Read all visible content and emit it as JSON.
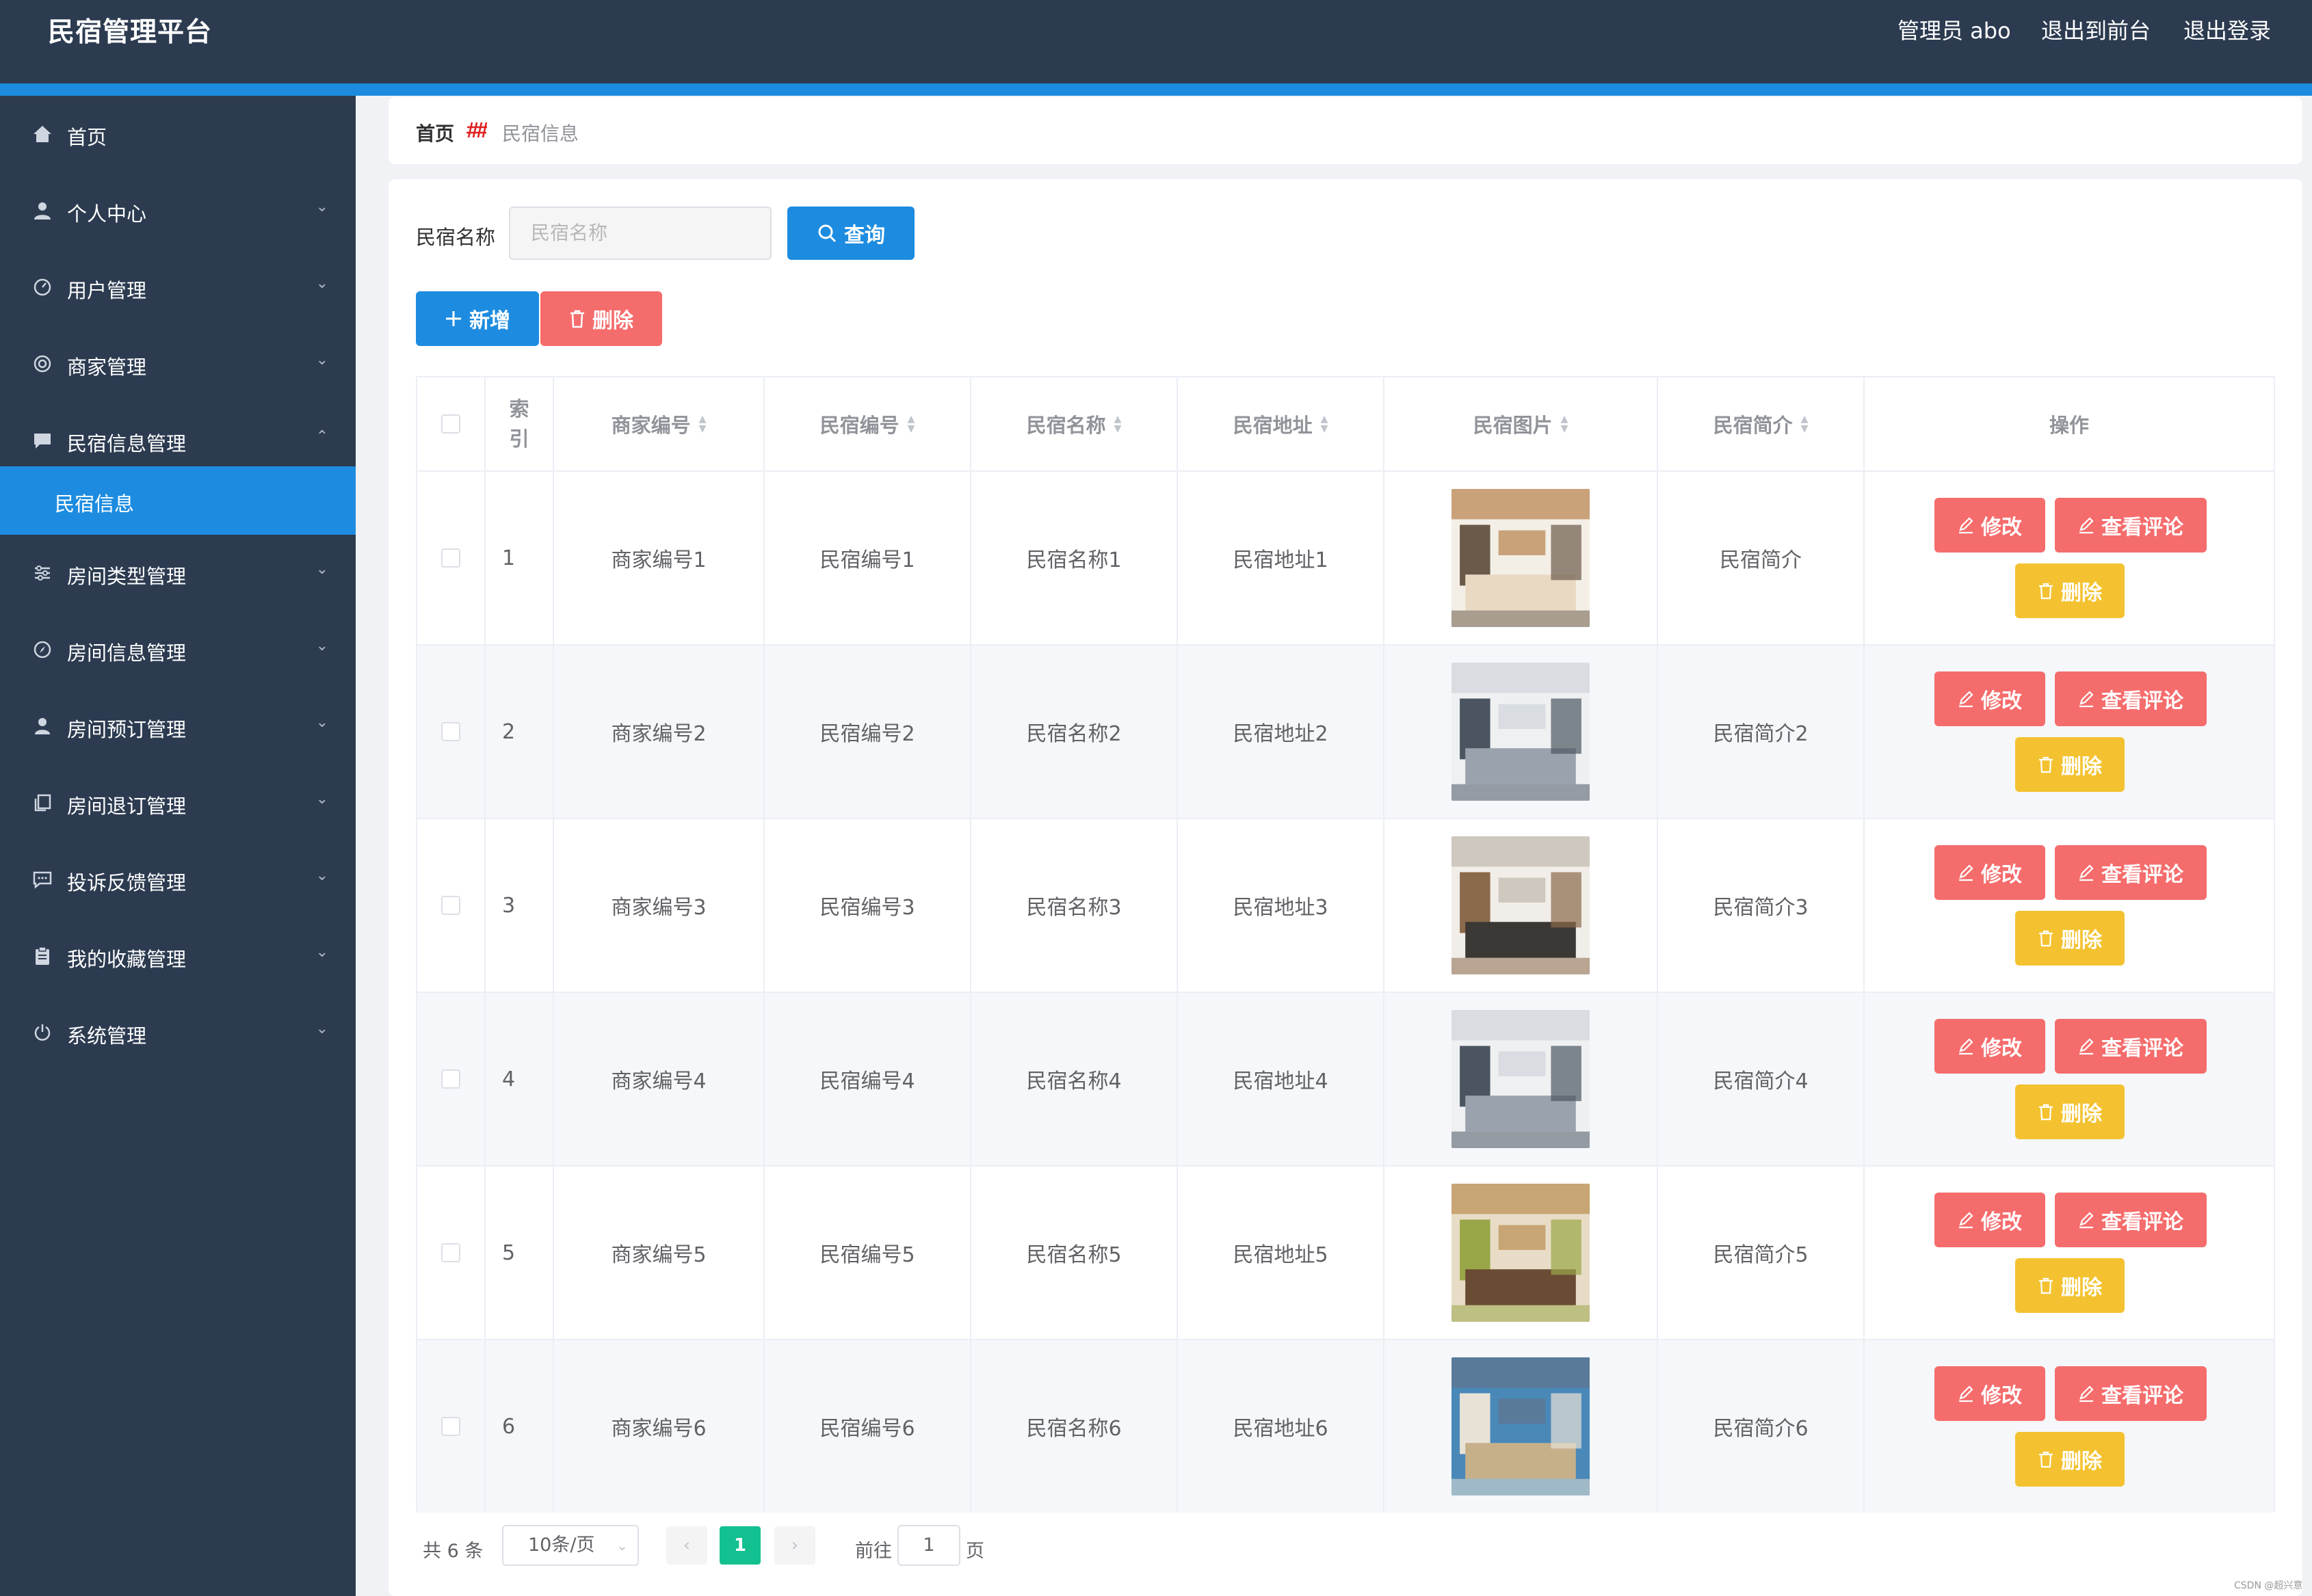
{
  "app": {
    "title": "民宿管理平台"
  },
  "topnav": {
    "admin": "管理员 abo",
    "to_front": "退出到前台",
    "logout": "退出登录"
  },
  "sidebar": {
    "items": [
      {
        "label": "首页",
        "icon": "home-icon"
      },
      {
        "label": "个人中心",
        "icon": "user-icon",
        "chevron": "⌄"
      },
      {
        "label": "用户管理",
        "icon": "gauge-icon",
        "chevron": "⌄"
      },
      {
        "label": "商家管理",
        "icon": "lifebuoy-icon",
        "chevron": "⌄"
      },
      {
        "label": "民宿信息管理",
        "icon": "chat-icon",
        "chevron": "⌃"
      },
      {
        "label": "房间类型管理",
        "icon": "sliders-icon",
        "chevron": "⌄"
      },
      {
        "label": "房间信息管理",
        "icon": "compass-icon",
        "chevron": "⌄"
      },
      {
        "label": "房间预订管理",
        "icon": "person-icon",
        "chevron": "⌄"
      },
      {
        "label": "房间退订管理",
        "icon": "copy-icon",
        "chevron": "⌄"
      },
      {
        "label": "投诉反馈管理",
        "icon": "message-icon",
        "chevron": "⌄"
      },
      {
        "label": "我的收藏管理",
        "icon": "clipboard-icon",
        "chevron": "⌄"
      },
      {
        "label": "系统管理",
        "icon": "power-icon",
        "chevron": "⌄"
      }
    ],
    "active_sub": "民宿信息"
  },
  "breadcrumb": {
    "home": "首页",
    "separator": "/",
    "current": "民宿信息"
  },
  "search": {
    "label": "民宿名称",
    "placeholder": "民宿名称",
    "button": "查询"
  },
  "actions": {
    "add": "新增",
    "delete": "删除"
  },
  "table": {
    "columns": [
      "",
      "索引",
      "商家编号",
      "民宿编号",
      "民宿名称",
      "民宿地址",
      "民宿图片",
      "民宿简介",
      "操作"
    ],
    "rows": [
      {
        "index": "1",
        "merchant": "商家编号1",
        "code": "民宿编号1",
        "name": "民宿名称1",
        "address": "民宿地址1",
        "intro": "民宿简介"
      },
      {
        "index": "2",
        "merchant": "商家编号2",
        "code": "民宿编号2",
        "name": "民宿名称2",
        "address": "民宿地址2",
        "intro": "民宿简介2"
      },
      {
        "index": "3",
        "merchant": "商家编号3",
        "code": "民宿编号3",
        "name": "民宿名称3",
        "address": "民宿地址3",
        "intro": "民宿简介3"
      },
      {
        "index": "4",
        "merchant": "商家编号4",
        "code": "民宿编号4",
        "name": "民宿名称4",
        "address": "民宿地址4",
        "intro": "民宿简介4"
      },
      {
        "index": "5",
        "merchant": "商家编号5",
        "code": "民宿编号5",
        "name": "民宿名称5",
        "address": "民宿地址5",
        "intro": "民宿简介5"
      },
      {
        "index": "6",
        "merchant": "商家编号6",
        "code": "民宿编号6",
        "name": "民宿名称6",
        "address": "民宿地址6",
        "intro": "民宿简介6"
      }
    ],
    "row_actions": {
      "edit": "修改",
      "comments": "查看评论",
      "delete": "删除"
    }
  },
  "pagination": {
    "total": "共 6 条",
    "page_size": "10条/页",
    "current_page": "1",
    "goto_label": "前往",
    "goto_value": "1",
    "page_unit": "页"
  },
  "watermark": "CSDN @超兴意",
  "colors": {
    "header": "#2c3b50",
    "accent": "#1d8ce0",
    "danger": "#f56c6c",
    "warning": "#f4c230",
    "pager_active": "#13c08f"
  }
}
